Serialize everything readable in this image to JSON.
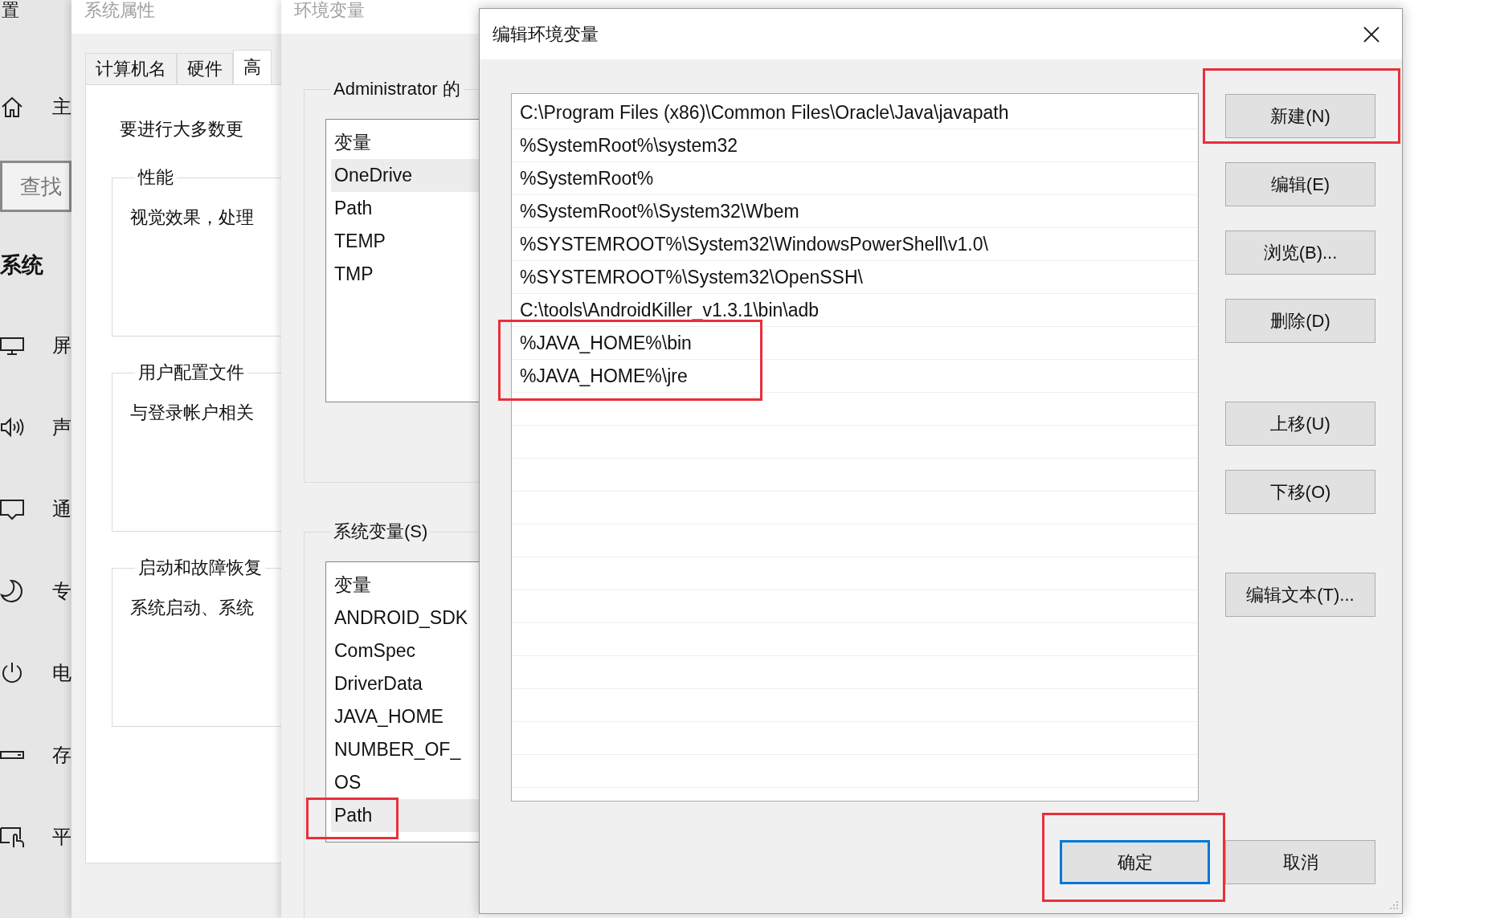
{
  "settings_window": {
    "title": "置",
    "search": {
      "placeholder": "查找"
    },
    "section": "系统",
    "nav_items": [
      {
        "kind": "home",
        "label": "主"
      },
      {
        "kind": "display",
        "label": "屏"
      },
      {
        "kind": "sound",
        "label": "声"
      },
      {
        "kind": "notifications",
        "label": "通"
      },
      {
        "kind": "focus",
        "label": "专"
      },
      {
        "kind": "power",
        "label": "电"
      },
      {
        "kind": "storage",
        "label": "存"
      },
      {
        "kind": "tablet",
        "label": "平"
      }
    ]
  },
  "system_properties": {
    "title": "系统属性",
    "tabs": [
      {
        "label": "计算机名",
        "selected": false
      },
      {
        "label": "硬件",
        "selected": false
      },
      {
        "label": "高",
        "selected": true
      }
    ],
    "intro": "要进行大多数更",
    "groups": [
      {
        "title": "性能",
        "text": "视觉效果，处理"
      },
      {
        "title": "用户配置文件",
        "text": "与登录帐户相关"
      },
      {
        "title": "启动和故障恢复",
        "text": "系统启动、系统"
      }
    ]
  },
  "environment_variables": {
    "title": "环境变量",
    "user_group": {
      "title": "Administrator 的",
      "column": "变量",
      "rows": [
        {
          "name": "OneDrive",
          "selected": true
        },
        {
          "name": "Path",
          "selected": false
        },
        {
          "name": "TEMP",
          "selected": false
        },
        {
          "name": "TMP",
          "selected": false
        }
      ]
    },
    "system_group": {
      "title": "系统变量(S)",
      "column": "变量",
      "rows": [
        {
          "name": "ANDROID_SDK",
          "selected": false
        },
        {
          "name": "ComSpec",
          "selected": false
        },
        {
          "name": "DriverData",
          "selected": false
        },
        {
          "name": "JAVA_HOME",
          "selected": false
        },
        {
          "name": "NUMBER_OF_",
          "selected": false
        },
        {
          "name": "OS",
          "selected": false
        },
        {
          "name": "Path",
          "selected": true
        }
      ]
    }
  },
  "edit_dialog": {
    "title": "编辑环境变量",
    "entries": [
      "C:\\Program Files (x86)\\Common Files\\Oracle\\Java\\javapath",
      "%SystemRoot%\\system32",
      "%SystemRoot%",
      "%SystemRoot%\\System32\\Wbem",
      "%SYSTEMROOT%\\System32\\WindowsPowerShell\\v1.0\\",
      "%SYSTEMROOT%\\System32\\OpenSSH\\",
      "C:\\tools\\AndroidKiller_v1.3.1\\bin\\adb",
      "%JAVA_HOME%\\bin",
      "%JAVA_HOME%\\jre"
    ],
    "side_buttons": [
      [
        "新建(N)",
        "编辑(E)",
        "浏览(B)...",
        "删除(D)"
      ],
      [
        "上移(U)",
        "下移(O)"
      ],
      [
        "编辑文本(T)..."
      ]
    ],
    "bottom_buttons": [
      {
        "label": "确定",
        "default": true
      },
      {
        "label": "取消",
        "default": false
      }
    ]
  }
}
